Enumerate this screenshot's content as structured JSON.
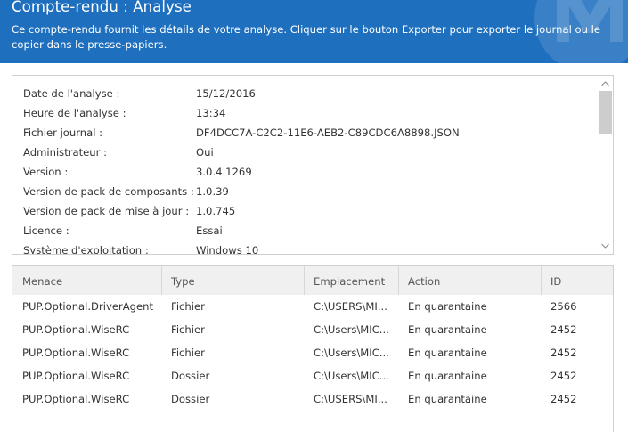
{
  "header": {
    "title": "Compte-rendu : Analyse",
    "description": "Ce compte-rendu fournit les détails de votre analyse. Cliquer sur le bouton Exporter pour exporter le journal ou le copier dans le presse-papiers.",
    "background_color": "#1f6fbf"
  },
  "info": {
    "rows": [
      {
        "label": "Date de l'analyse :",
        "value": "15/12/2016"
      },
      {
        "label": "Heure de l'analyse :",
        "value": "13:34"
      },
      {
        "label": "Fichier journal :",
        "value": "DF4DCC7A-C2C2-11E6-AEB2-C89CDC6A8898.JSON"
      },
      {
        "label": "Administrateur :",
        "value": "Oui"
      },
      {
        "label": "Version :",
        "value": "3.0.4.1269"
      },
      {
        "label": "Version de pack de composants :",
        "value": "1.0.39"
      },
      {
        "label": "Version de pack de mise à jour :",
        "value": "1.0.745"
      },
      {
        "label": "Licence :",
        "value": "Essai"
      },
      {
        "label": "Système d'exploitation :",
        "value": "Windows 10"
      }
    ]
  },
  "threats_table": {
    "columns": [
      "Menace",
      "Type",
      "Emplacement",
      "Action",
      "ID"
    ],
    "rows": [
      [
        "PUP.Optional.DriverAgent",
        "Fichier",
        "C:\\USERS\\MI...",
        "En quarantaine",
        "2566"
      ],
      [
        "PUP.Optional.WiseRC",
        "Fichier",
        "C:\\Users\\MIC...",
        "En quarantaine",
        "2452"
      ],
      [
        "PUP.Optional.WiseRC",
        "Fichier",
        "C:\\Users\\MIC...",
        "En quarantaine",
        "2452"
      ],
      [
        "PUP.Optional.WiseRC",
        "Dossier",
        "C:\\Users\\MIC...",
        "En quarantaine",
        "2452"
      ],
      [
        "PUP.Optional.WiseRC",
        "Dossier",
        "C:\\USERS\\MI...",
        "En quarantaine",
        "2452"
      ]
    ]
  },
  "icons": {
    "scroll_up": "chevron-up-icon",
    "scroll_down": "chevron-down-icon",
    "watermark": "malwarebytes-logo-icon"
  }
}
